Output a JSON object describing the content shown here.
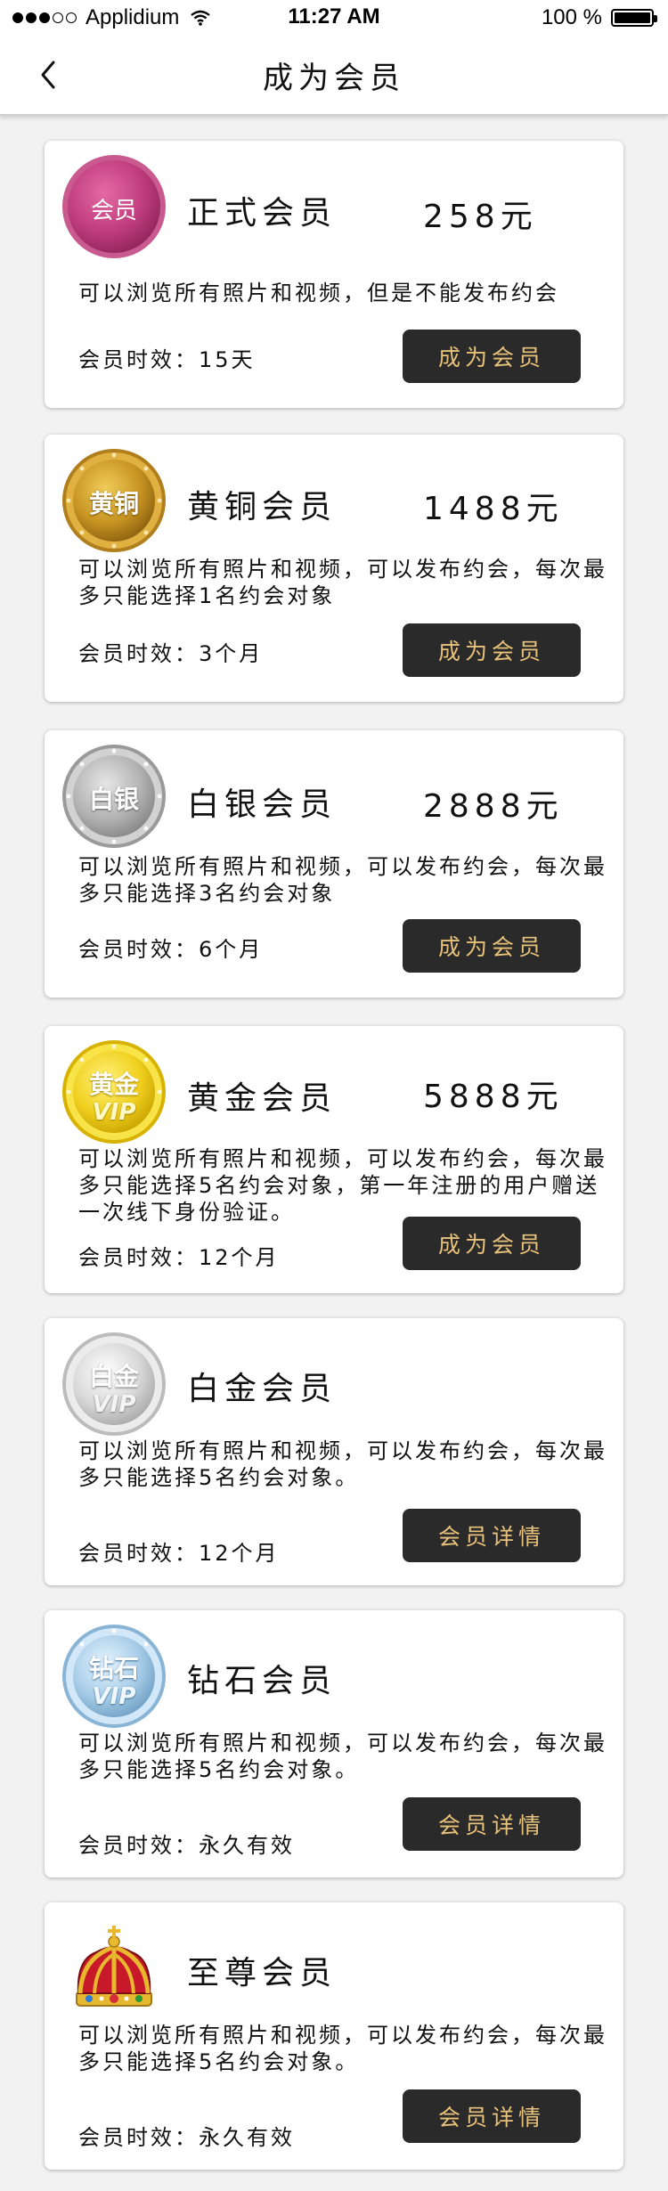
{
  "status_bar": {
    "carrier": "Applidium",
    "time": "11:27 AM",
    "battery": "100 %"
  },
  "nav": {
    "title": "成为会员"
  },
  "tiers": [
    {
      "badge_text": "会员",
      "name": "正式会员",
      "price": "258元",
      "description": "可以浏览所有照片和视频，但是不能发布约会",
      "duration": "会员时效：15天",
      "button": "成为会员"
    },
    {
      "badge_text": "黄铜",
      "name": "黄铜会员",
      "price": "1488元",
      "description": "可以浏览所有照片和视频，可以发布约会，每次最多只能选择1名约会对象",
      "duration": "会员时效：3个月",
      "button": "成为会员"
    },
    {
      "badge_text": "白银",
      "name": "白银会员",
      "price": "2888元",
      "description": "可以浏览所有照片和视频，可以发布约会，每次最多只能选择3名约会对象",
      "duration": "会员时效：6个月",
      "button": "成为会员"
    },
    {
      "badge_text": "黄金",
      "badge_sub": "VIP",
      "name": "黄金会员",
      "price": "5888元",
      "description": "可以浏览所有照片和视频，可以发布约会，每次最多只能选择5名约会对象，第一年注册的用户赠送一次线下身份验证。",
      "duration": "会员时效：12个月",
      "button": "成为会员"
    },
    {
      "badge_text": "白金",
      "badge_sub": "VIP",
      "name": "白金会员",
      "description": "可以浏览所有照片和视频，可以发布约会，每次最多只能选择5名约会对象。",
      "duration": "会员时效：12个月",
      "button": "会员详情"
    },
    {
      "badge_text": "钻石",
      "badge_sub": "VIP",
      "name": "钻石会员",
      "description": "可以浏览所有照片和视频，可以发布约会，每次最多只能选择5名约会对象。",
      "duration": "会员时效：永久有效",
      "button": "会员详情"
    },
    {
      "badge_icon": "crown-icon",
      "name": "至尊会员",
      "description": "可以浏览所有照片和视频，可以发布约会，每次最多只能选择5名约会对象。",
      "duration": "会员时效：永久有效",
      "button": "会员详情"
    }
  ],
  "colors": {
    "button_bg": "#2a2a2a",
    "button_text": "#e8c27a",
    "page_bg": "#f2f2f2"
  }
}
